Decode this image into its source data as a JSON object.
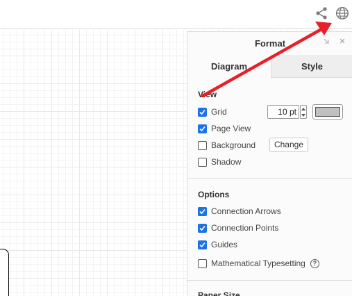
{
  "toolbar": {
    "share_icon": "share-icon",
    "globe_icon": "globe-icon"
  },
  "panel": {
    "title": "Format",
    "close_glyph": "×",
    "tabs": [
      {
        "label": "Diagram",
        "active": true
      },
      {
        "label": "Style",
        "active": false
      }
    ],
    "view": {
      "title": "View",
      "grid": {
        "label": "Grid",
        "checked": true,
        "size_value": "10 pt",
        "color": "#c0c0c0"
      },
      "page_view": {
        "label": "Page View",
        "checked": true
      },
      "background": {
        "label": "Background",
        "checked": false,
        "button_label": "Change"
      },
      "shadow": {
        "label": "Shadow",
        "checked": false
      }
    },
    "options": {
      "title": "Options",
      "connection_arrows": {
        "label": "Connection Arrows",
        "checked": true
      },
      "connection_points": {
        "label": "Connection Points",
        "checked": true
      },
      "guides": {
        "label": "Guides",
        "checked": true
      },
      "math_typesetting": {
        "label": "Mathematical Typesetting",
        "checked": false,
        "help_glyph": "?"
      }
    },
    "paper_size": {
      "title": "Paper Size"
    }
  },
  "colors": {
    "accent": "#1a73e8",
    "annotation_arrow": "#e8202a"
  }
}
